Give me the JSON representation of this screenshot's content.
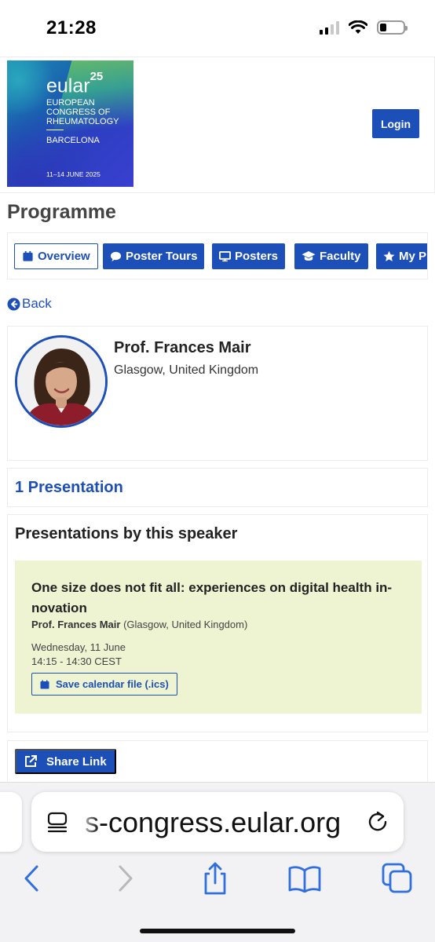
{
  "status_bar": {
    "time": "21:28",
    "battery_level": 0.3
  },
  "header": {
    "logo": {
      "brand": "eular",
      "edition": "25",
      "subtitle": "EUROPEAN CONGRESS OF RHEUMATOLOGY",
      "city": "BARCELONA",
      "dates": "11–14 JUNE 2025"
    },
    "login_label": "Login"
  },
  "page_title": "Programme",
  "tabs": [
    {
      "label": "Overview",
      "icon": "calendar-icon",
      "active": true
    },
    {
      "label": "Poster Tours",
      "icon": "chat-icon",
      "active": false
    },
    {
      "label": "Posters",
      "icon": "monitor-icon",
      "active": false
    },
    {
      "label": "Faculty",
      "icon": "graduation-cap-icon",
      "active": false
    },
    {
      "label": "My P",
      "icon": "star-icon",
      "active": false
    }
  ],
  "back_label": "Back",
  "speaker": {
    "name": "Prof. Frances Mair",
    "location": "Glasgow, United Kingdom"
  },
  "presentation_count": "1 Presentation",
  "presentations_heading": "Presentations by this speaker",
  "presentation": {
    "title": "One size does not fit all: experiences on digital health in-novation",
    "speaker_name": "Prof. Frances Mair",
    "speaker_location": "(Glasgow, United Kingdom)",
    "date": "Wednesday, 11 June",
    "time": "14:15 - 14:30 CEST",
    "calendar_label": "Save calendar file (.ics)"
  },
  "share_label": "Share Link",
  "browser": {
    "url": "s-congress.eular.org"
  },
  "colors": {
    "primary": "#1d4fb8",
    "presentation_card": "#eef3d2"
  }
}
